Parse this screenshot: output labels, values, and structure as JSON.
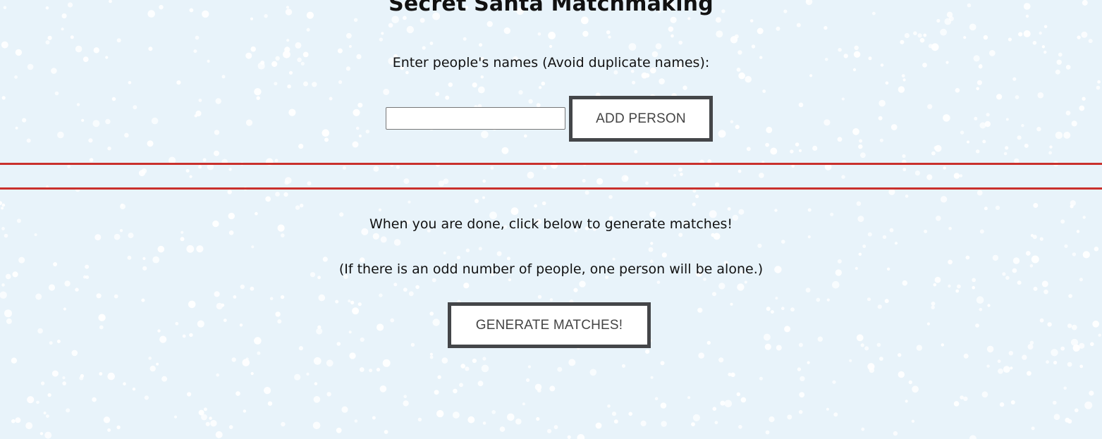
{
  "header": {
    "title": "Secret Santa Matchmaking"
  },
  "add_section": {
    "prompt": "Enter people's names (Avoid duplicate names):",
    "name_input_value": "",
    "add_button_label": "ADD PERSON"
  },
  "generate_section": {
    "instruction": "When you are done, click below to generate matches!",
    "note": "(If there is an odd number of people, one person will be alone.)",
    "generate_button_label": "GENERATE MATCHES!"
  },
  "colors": {
    "background": "#e8f3fa",
    "divider": "#c9302c",
    "button_border": "#444649",
    "snow": "#ffffff"
  }
}
